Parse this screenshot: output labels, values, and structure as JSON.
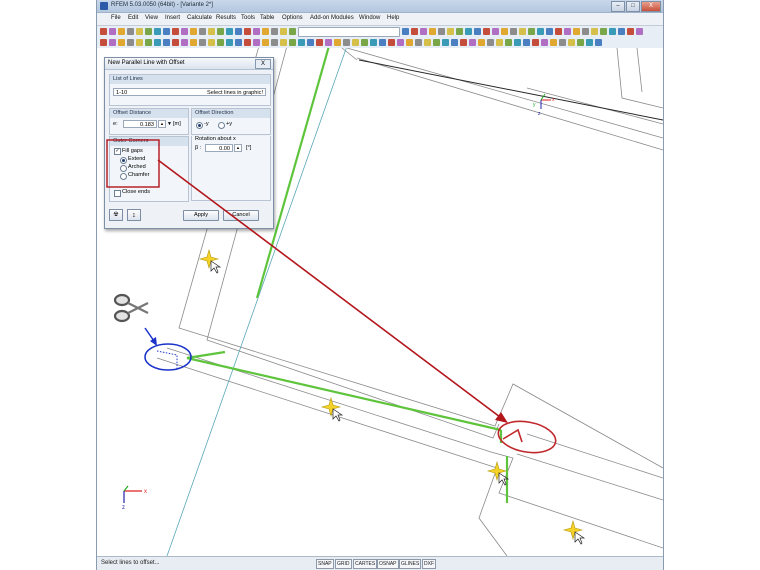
{
  "window": {
    "title": "RFEM 5.03.0050 (64bit) - [Variante 2*]",
    "minimize": "–",
    "maximize": "□",
    "close": "X"
  },
  "menu": [
    "File",
    "Edit",
    "View",
    "Insert",
    "Calculate",
    "Results",
    "Tools",
    "Table",
    "Options",
    "Add-on Modules",
    "Window",
    "Help"
  ],
  "dialog": {
    "title": "New Parallel Line with Offset",
    "close": "X",
    "list_of_lines": {
      "header": "List of Lines",
      "value": "1-10",
      "hint": "Select lines in graphic!"
    },
    "offset_distance": {
      "header": "Offset Distance",
      "label": "e:",
      "value": "0.183",
      "unit": "[m]"
    },
    "offset_direction": {
      "header": "Offset Direction",
      "options": [
        "-y",
        "+y"
      ],
      "selected": "-y"
    },
    "outer_corners": {
      "header": "Outer Corners",
      "fill_gaps_label": "Fill gaps",
      "fill_gaps_checked": true,
      "options": [
        "Extend",
        "Arched",
        "Chamfer"
      ],
      "selected": "Extend",
      "close_ends_label": "Close ends",
      "close_ends_checked": false
    },
    "rotation": {
      "label": "Rotation about x",
      "beta_label": "β :",
      "value": "0.00",
      "unit": "[°]"
    },
    "apply_label": "Apply",
    "cancel_label": "Cancel"
  },
  "status": {
    "message": "Select lines to offset...",
    "buttons": [
      "SNAP",
      "GRID",
      "CARTES",
      "OSNAP",
      "GLINES",
      "DXF"
    ]
  },
  "axes": {
    "x_label": "x",
    "y_label": "y",
    "z_label": "z"
  },
  "colors": {
    "line_green": "#5ec43c",
    "arrow_red": "#b3161b",
    "ellipse_blue": "#1b33c9",
    "ellipse_red": "#c0282c"
  },
  "icons": [
    "scissors-icon",
    "cursor-sparkle-icon"
  ]
}
